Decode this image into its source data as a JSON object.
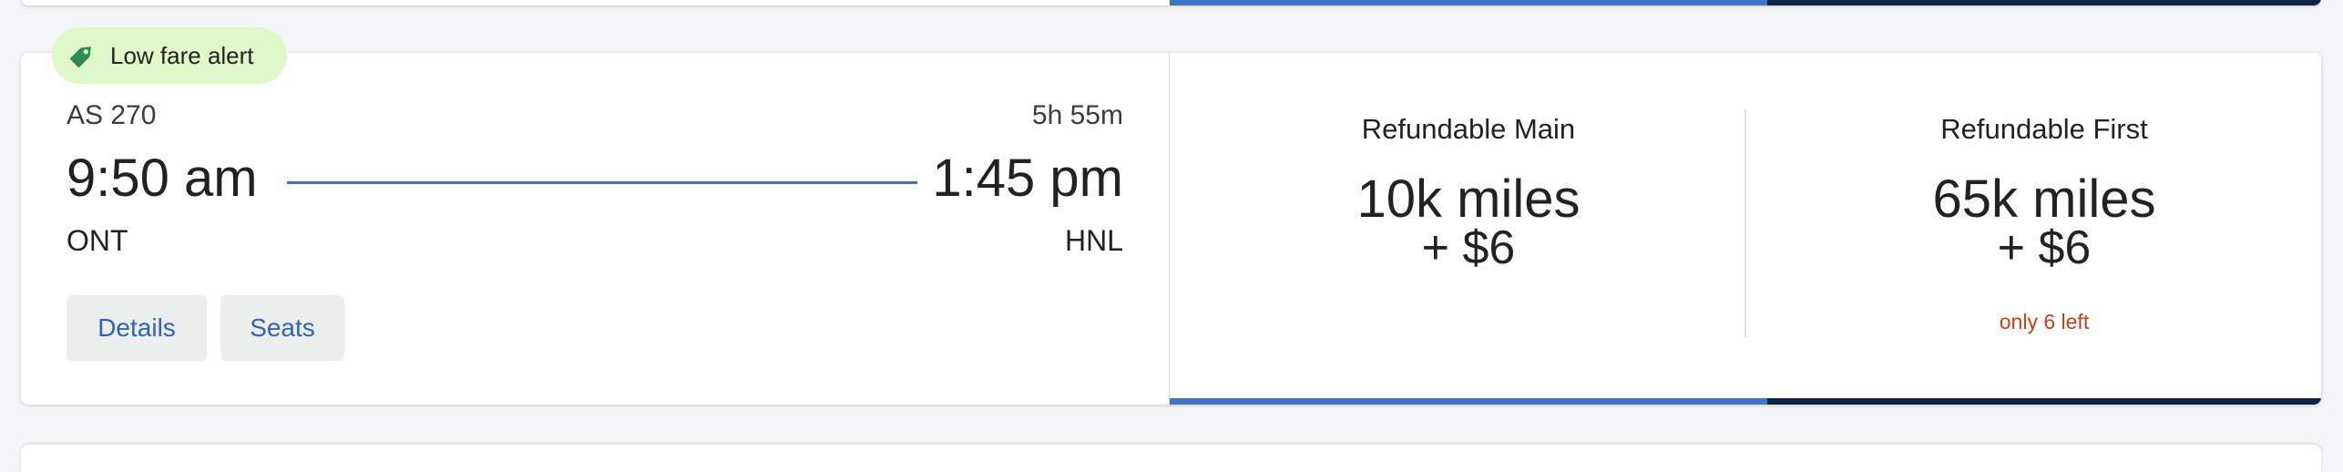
{
  "badge": {
    "label": "Low fare alert",
    "color": "#dff8c9",
    "icon": "price-tag-icon"
  },
  "flight": {
    "number": "AS 270",
    "duration": "5h 55m",
    "departure_time": "9:50 am",
    "arrival_time": "1:45 pm",
    "departure_airport": "ONT",
    "arrival_airport": "HNL"
  },
  "buttons": {
    "details": "Details",
    "seats": "Seats"
  },
  "fares": [
    {
      "name": "Refundable Main",
      "miles": "10k miles",
      "cash": "+ $6",
      "note": "",
      "bar_color": "#3a77c8"
    },
    {
      "name": "Refundable First",
      "miles": "65k miles",
      "cash": "+ $6",
      "note": "only 6 left",
      "bar_color": "#0e2443"
    }
  ],
  "colors": {
    "accent": "#3a6fc2",
    "note": "#c4401b"
  }
}
